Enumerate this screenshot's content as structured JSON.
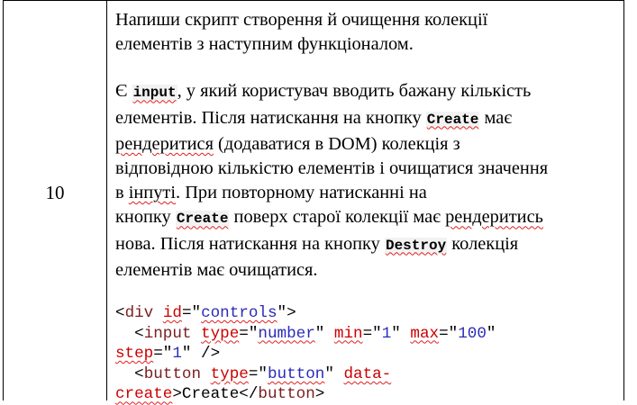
{
  "row_number": "10",
  "p1": {
    "l1": "Напиши скрипт створення й очищення колекції",
    "l2": "елементів з наступним функціоналом."
  },
  "p2": {
    "l1a": "Є ",
    "l1_code": "input",
    "l1b": ", у який користувач вводить бажану кількість",
    "l2a": "елементів. Після натискання на кнопку ",
    "l2_code": "Create",
    "l2b": " має",
    "l3a": "рендеритися",
    "l3b": " (додаватися в DOM) колекція з",
    "l4": "відповідною кількістю елементів і очищатися значення",
    "l5a": "в ",
    "l5_sq": "інпуті",
    "l5b": ". При повторному натисканні на",
    "l6a": "кнопку ",
    "l6_code": "Create",
    "l6b": " поверх старої колекції має ",
    "l6_sq": "рендеритись",
    "l7a": "нова. Після натискання на кнопку ",
    "l7_code": "Destroy",
    "l7b": " колекція",
    "l8": "елементів має очищатися."
  },
  "code": {
    "c1_open": "<",
    "c1_tag": "div",
    "c1_attr": "id",
    "c1_eq": "=\"",
    "c1_val": "controls",
    "c1_close": "\">",
    "c2_indent": "  ",
    "c2_open": "<",
    "c2_tag": "input",
    "c2_sp1": " ",
    "c2_attr1": "type",
    "c2_eq1": "=\"",
    "c2_val1": "number",
    "c2_q1": "\" ",
    "c2_attr2": "min",
    "c2_eq2": "=\"",
    "c2_val2": "1",
    "c2_q2": "\" ",
    "c2_attr3": "max",
    "c2_eq3": "=\"",
    "c2_val3": "100",
    "c2_q3": "\"",
    "c3_attr": "step",
    "c3_eq": "=\"",
    "c3_val": "1",
    "c3_close": "\" />",
    "c4_indent": "  ",
    "c4_open": "<",
    "c4_tag": "button",
    "c4_sp": " ",
    "c4_attr1": "type",
    "c4_eq": "=\"",
    "c4_val": "button",
    "c4_q": "\" ",
    "c4_attr2": "data-",
    "c5_attr": "create",
    "c5_gt": ">",
    "c5_text": "Create",
    "c5_close_open": "</",
    "c5_tag": "button",
    "c5_gt2": ">"
  }
}
